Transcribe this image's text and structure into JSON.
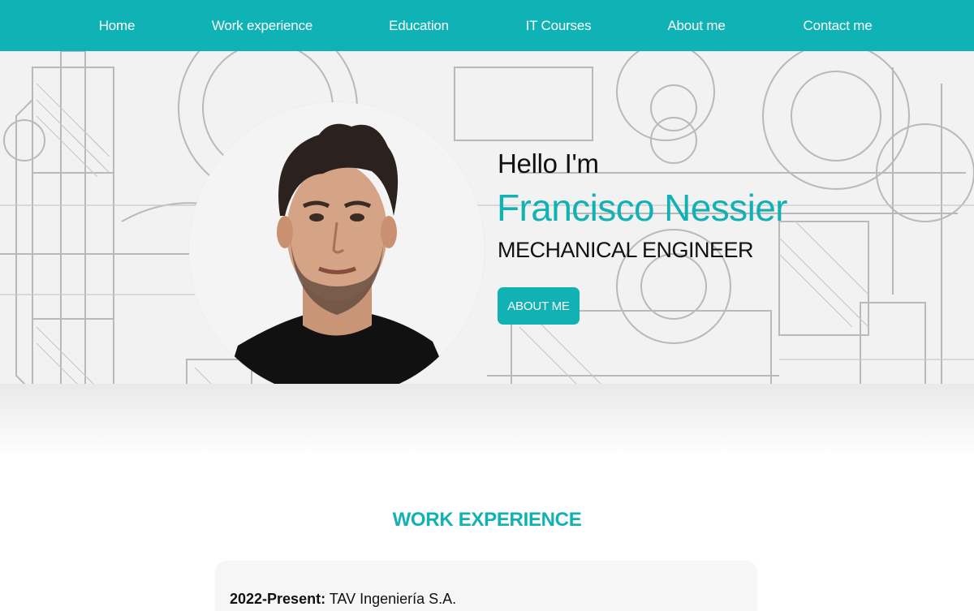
{
  "nav": {
    "items": [
      {
        "label": "Home"
      },
      {
        "label": "Work experience"
      },
      {
        "label": "Education"
      },
      {
        "label": "IT Courses"
      },
      {
        "label": "About me"
      },
      {
        "label": "Contact me"
      }
    ]
  },
  "hero": {
    "greeting": "Hello I'm",
    "name": "Francisco Nessier",
    "role": "MECHANICAL ENGINEER",
    "button_label": "ABOUT ME"
  },
  "work": {
    "title": "WORK EXPERIENCE",
    "entries": [
      {
        "period": "2022-Present:",
        "company": "TAV Ingeniería S.A."
      }
    ]
  },
  "colors": {
    "accent": "#12b1b3",
    "nav_bg": "#0fb3b5"
  }
}
